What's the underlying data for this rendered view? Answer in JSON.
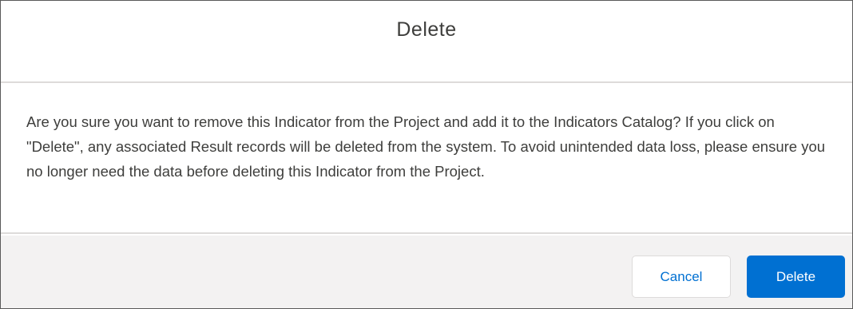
{
  "modal": {
    "title": "Delete",
    "message": "Are you sure you want to remove this Indicator from the Project and add it to the Indicators Catalog? If you click on \"Delete\", any associated Result records will be deleted from the system. To avoid unintended data loss, please ensure you no longer need the data before deleting this Indicator from the Project.",
    "cancel_label": "Cancel",
    "delete_label": "Delete"
  },
  "colors": {
    "brand": "#0070d2",
    "footer_background": "#f3f2f2",
    "border": "#dddbda",
    "text": "#3e3e3c"
  }
}
